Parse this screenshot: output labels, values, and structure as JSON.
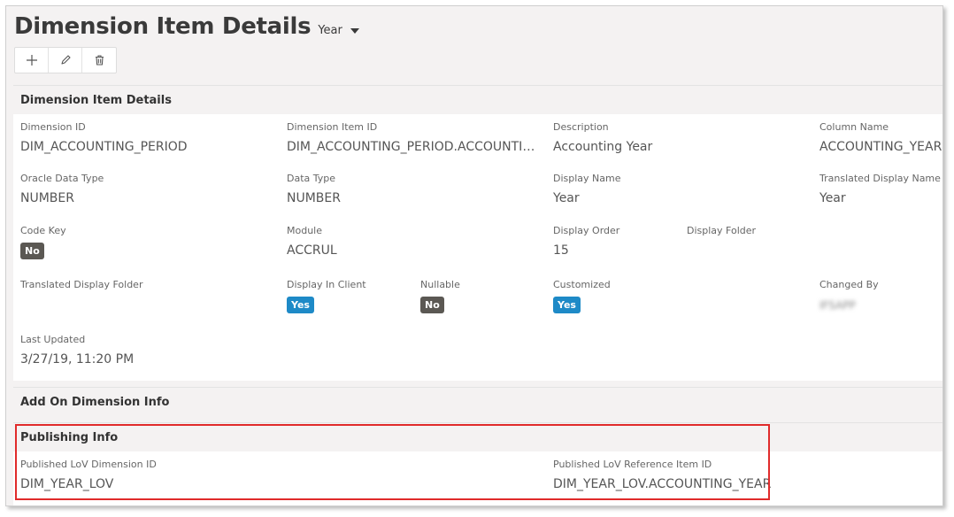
{
  "header": {
    "title": "Dimension Item Details",
    "context_selector": "Year"
  },
  "toolbar": {
    "buttons": [
      {
        "name": "add-button",
        "icon": "plus-icon"
      },
      {
        "name": "edit-button",
        "icon": "pencil-icon"
      },
      {
        "name": "delete-button",
        "icon": "trash-icon"
      }
    ]
  },
  "details": {
    "title": "Dimension Item Details",
    "dimension_id": {
      "label": "Dimension ID",
      "value": "DIM_ACCOUNTING_PERIOD"
    },
    "dimension_item_id": {
      "label": "Dimension Item ID",
      "value": "DIM_ACCOUNTING_PERIOD.ACCOUNTING..."
    },
    "description": {
      "label": "Description",
      "value": "Accounting Year"
    },
    "column_name": {
      "label": "Column Name",
      "value": "ACCOUNTING_YEAR"
    },
    "oracle_data_type": {
      "label": "Oracle Data Type",
      "value": "NUMBER"
    },
    "data_type": {
      "label": "Data Type",
      "value": "NUMBER"
    },
    "display_name": {
      "label": "Display Name",
      "value": "Year"
    },
    "translated_display_name": {
      "label": "Translated Display Name",
      "value": "Year"
    },
    "code_key": {
      "label": "Code Key",
      "value": "No"
    },
    "module": {
      "label": "Module",
      "value": "ACCRUL"
    },
    "display_order": {
      "label": "Display Order",
      "value": "15"
    },
    "display_folder": {
      "label": "Display Folder",
      "value": ""
    },
    "translated_display_folder": {
      "label": "Translated Display Folder",
      "value": ""
    },
    "display_in_client": {
      "label": "Display In Client",
      "value": "Yes"
    },
    "nullable": {
      "label": "Nullable",
      "value": "No"
    },
    "customized": {
      "label": "Customized",
      "value": "Yes"
    },
    "changed_by": {
      "label": "Changed By",
      "value": "IFSAPP"
    },
    "last_updated": {
      "label": "Last Updated",
      "value": "3/27/19, 11:20 PM"
    }
  },
  "add_on": {
    "title": "Add On Dimension Info"
  },
  "publishing": {
    "title": "Publishing Info",
    "lov_dimension_id": {
      "label": "Published LoV Dimension ID",
      "value": "DIM_YEAR_LOV"
    },
    "lov_reference_item_id": {
      "label": "Published LoV Reference Item ID",
      "value": "DIM_YEAR_LOV.ACCOUNTING_YEAR"
    }
  },
  "colors": {
    "badge_yes": "#1e8ac7",
    "badge_no": "#5b5853",
    "highlight": "#e02b2b"
  }
}
